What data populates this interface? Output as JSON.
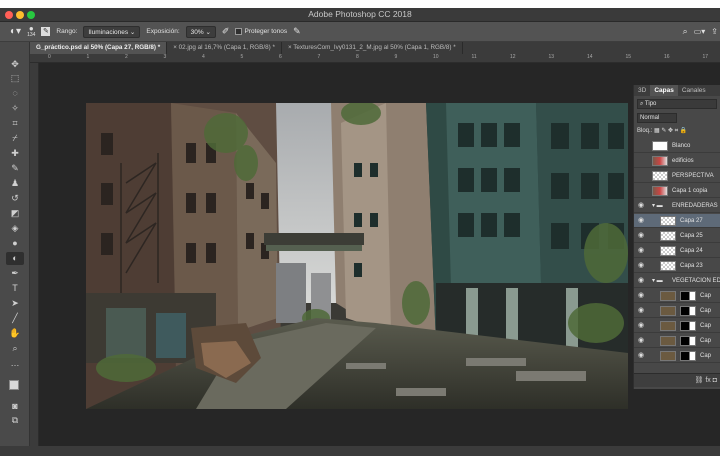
{
  "window": {
    "title": "Adobe Photoshop CC 2018"
  },
  "options_bar": {
    "brush_size": "134",
    "range_label": "Rango:",
    "range_value": "Iluminaciones",
    "exposure_label": "Exposición:",
    "exposure_value": "30%",
    "protect_tones_label": "Proteger tonos"
  },
  "document_tabs": [
    {
      "label": "G_práctico.psd al 50% (Capa 27, RGB/8) *",
      "active": true
    },
    {
      "label": "02.jpg al 16,7% (Capa 1, RGB/8) *",
      "active": false
    },
    {
      "label": "TexturesCom_Ivy0131_2_M.jpg al 50% (Capa 1, RGB/8) *",
      "active": false
    }
  ],
  "ruler_ticks": [
    "0",
    "1",
    "2",
    "3",
    "4",
    "5",
    "6",
    "7",
    "8",
    "9",
    "10",
    "11",
    "12",
    "13",
    "14",
    "15",
    "16",
    "17",
    "18"
  ],
  "layers_panel": {
    "tabs": [
      "3D",
      "Capas",
      "Canales"
    ],
    "active_tab": "Capas",
    "filter_label": "Tipo",
    "blend_mode": "Normal",
    "lock_label": "Bloq.:",
    "layers": [
      {
        "name": "Blanco",
        "kind": "adjustment",
        "indent": 0,
        "visible": false,
        "selected": false
      },
      {
        "name": "edificios",
        "kind": "image",
        "indent": 0,
        "visible": false,
        "selected": false
      },
      {
        "name": "PERSPECTIVA",
        "kind": "transparent",
        "indent": 0,
        "visible": false,
        "selected": false
      },
      {
        "name": "Capa 1 copia",
        "kind": "image",
        "indent": 0,
        "visible": false,
        "selected": false
      },
      {
        "name": "ENREDADERAS",
        "kind": "group",
        "indent": 0,
        "visible": true,
        "selected": false
      },
      {
        "name": "Capa 27",
        "kind": "transparent",
        "indent": 1,
        "visible": true,
        "selected": true
      },
      {
        "name": "Capa 25",
        "kind": "transparent",
        "indent": 1,
        "visible": true,
        "selected": false
      },
      {
        "name": "Capa 24",
        "kind": "transparent",
        "indent": 1,
        "visible": true,
        "selected": false
      },
      {
        "name": "Capa 23",
        "kind": "transparent",
        "indent": 1,
        "visible": true,
        "selected": false
      },
      {
        "name": "VEGETACION EDI",
        "kind": "group",
        "indent": 0,
        "visible": true,
        "selected": false
      },
      {
        "name": "Cap",
        "kind": "masked",
        "indent": 1,
        "visible": true,
        "selected": false
      },
      {
        "name": "Cap",
        "kind": "masked",
        "indent": 1,
        "visible": true,
        "selected": false
      },
      {
        "name": "Cap",
        "kind": "masked",
        "indent": 1,
        "visible": true,
        "selected": false
      },
      {
        "name": "Cap",
        "kind": "masked",
        "indent": 1,
        "visible": true,
        "selected": false
      },
      {
        "name": "Cap",
        "kind": "masked",
        "indent": 1,
        "visible": true,
        "selected": false
      }
    ],
    "footer_icons": [
      "link-icon",
      "fx-icon",
      "mask-icon"
    ],
    "footer_fx": "fx"
  },
  "colors": {
    "window_chrome": "#3a3a3a",
    "panel": "#484848",
    "selected_layer": "#5e6a78",
    "pasteboard": "#262626"
  }
}
